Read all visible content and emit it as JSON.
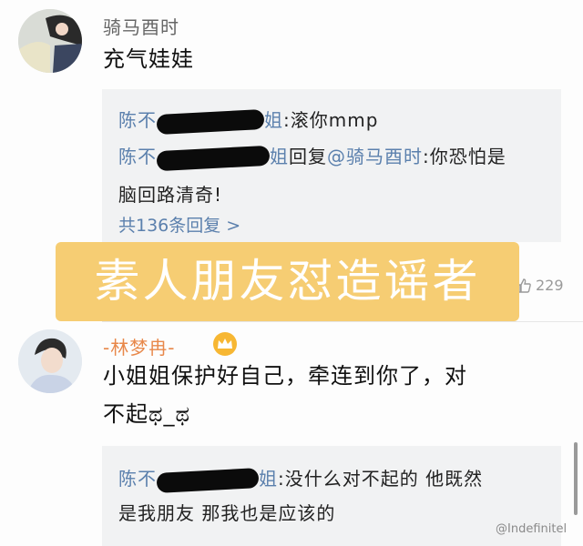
{
  "comments": [
    {
      "username": "骑马酉时",
      "text": "充气娃娃",
      "replies": [
        {
          "name_start": "陈不",
          "name_end": "姐",
          "text": ":滚你mmp"
        },
        {
          "name_start": "陈不",
          "name_end": "姐",
          "verb": "回复",
          "mention": "@骑马酉时",
          "text": ":你恐怕是",
          "text2": "脑回路清奇!"
        }
      ],
      "more_replies": "共136条回复 >",
      "like_count": "229"
    },
    {
      "username": "-林梦冉-",
      "text_line1": "小姐姐保护好自己，牵连到你了，对",
      "text_line2": "不起ಥ_ಥ",
      "replies": [
        {
          "name_start": "陈不",
          "name_end": "姐",
          "text": ":没什么对不起的 他既然",
          "text2": "是我朋友 那我也是应该的"
        }
      ]
    }
  ],
  "banner": {
    "text": "素人朋友怼造谣者",
    "color": "#f6cd73"
  },
  "watermark": "@Indefinitel",
  "colors": {
    "link": "#5b80ad",
    "vip_name": "#e8884a",
    "reply_bg": "#f1f2f3"
  },
  "icons": {
    "crown": "crown-icon",
    "like": "thumbs-up-icon"
  }
}
